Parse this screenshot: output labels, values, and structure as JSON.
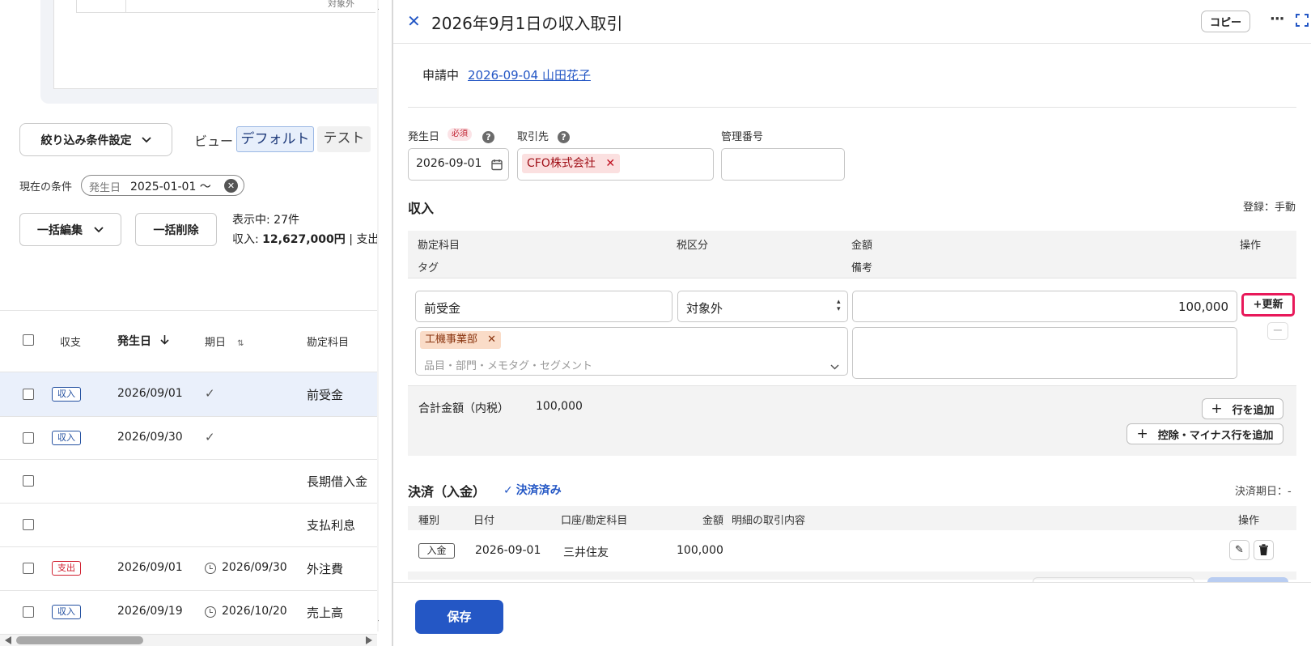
{
  "left": {
    "top_table_label": "対象外",
    "filter_button": "絞り込み条件設定",
    "view_label": "ビュー",
    "view_tabs": [
      "デフォルト",
      "テスト"
    ],
    "current_condition_label": "現在の条件",
    "condition_chip_key": "発生日",
    "condition_chip_value": "2025-01-01 〜",
    "bulk_edit": "一括編集",
    "bulk_delete": "一括削除",
    "display_count": "表示中: 27件",
    "income_summary_prefix": "収入: ",
    "income_summary_amount": "12,627,000円",
    "income_summary_suffix": " | 支出",
    "columns": [
      "収支",
      "発生日",
      "期日",
      "勘定科目"
    ],
    "rows": [
      {
        "type": "収入",
        "date": "2026/09/01",
        "due": "",
        "due_check": true,
        "due_clock": false,
        "account": "前受金"
      },
      {
        "type": "収入",
        "date": "2026/09/30",
        "due": "",
        "due_check": true,
        "due_clock": false,
        "account": ""
      },
      {
        "type": "",
        "date": "",
        "due": "",
        "due_check": false,
        "due_clock": false,
        "account": "長期借入金"
      },
      {
        "type": "",
        "date": "",
        "due": "",
        "due_check": false,
        "due_clock": false,
        "account": "支払利息"
      },
      {
        "type": "支出",
        "date": "2026/09/01",
        "due": "2026/09/30",
        "due_check": false,
        "due_clock": true,
        "account": "外注費"
      },
      {
        "type": "収入",
        "date": "2026/09/19",
        "due": "2026/10/20",
        "due_check": false,
        "due_clock": true,
        "account": "売上高"
      }
    ]
  },
  "panel": {
    "title": "2026年9月1日の収入取引",
    "copy_button": "コピー",
    "more_icon": "more-icon",
    "expand_icon": "expand-icon",
    "status": "申請中",
    "applicant_link": "2026-09-04 山田花子",
    "date_label": "発生日",
    "required_badge": "必須",
    "date_value": "2026-09-01",
    "partner_label": "取引先",
    "partner_chip": "CFO株式会社",
    "mgmt_label": "管理番号",
    "mgmt_value": "",
    "income_section": "収入",
    "register_mode": "登録：手動",
    "detail_headers": {
      "account": "勘定科目",
      "tax": "税区分",
      "amount": "金額",
      "ops": "操作",
      "tag": "タグ",
      "note": "備考"
    },
    "detail_row": {
      "account": "前受金",
      "tax": "対象外",
      "amount": "100,000",
      "tag_chip": "工機事業部",
      "tag_placeholder": "品目・部門・メモタグ・セグメント",
      "note": ""
    },
    "update_button": "+更新",
    "total_label": "合計金額（内税）",
    "total_value": "100,000",
    "add_row": "行を追加",
    "add_minus_row": "控除・マイナス行を追加",
    "settle_section": "決済（入金）",
    "settle_status": "決済済み",
    "settle_due": "決済期日：-",
    "settle_headers": [
      "種別",
      "日付",
      "口座/勘定科目",
      "金額",
      "明細の取引内容",
      "操作"
    ],
    "settle_row": {
      "kind": "入金",
      "date": "2026-09-01",
      "account": "三井住友",
      "amount": "100,000",
      "desc": ""
    },
    "save_button": "保存"
  },
  "colors": {
    "accent": "#2457c5",
    "highlight": "#e8195a",
    "selected_row": "#eaf0fb"
  }
}
